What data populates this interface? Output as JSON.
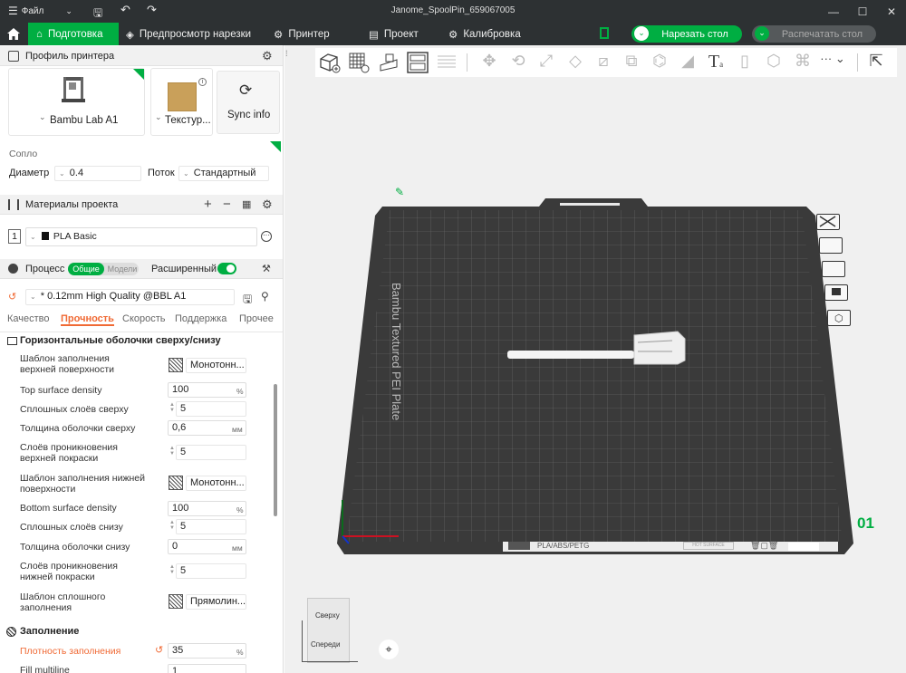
{
  "window": {
    "title": "Janome_SpoolPin_659067005",
    "menu_label": "Файл"
  },
  "nav": {
    "tabs": [
      "Подготовка",
      "Предпросмотр нарезки",
      "Принтер",
      "Проект",
      "Калибровка"
    ],
    "slice_button": "Нарезать стол",
    "print_button": "Распечатать стол"
  },
  "printer_profile": {
    "header": "Профиль принтера",
    "printer_name": "Bambu Lab A1",
    "plate_name": "Текстур...",
    "sync_label": "Sync info",
    "nozzle_label": "Сопло",
    "diameter_label": "Диаметр",
    "diameter_value": "0.4",
    "flow_label": "Поток",
    "flow_value": "Стандартный"
  },
  "materials": {
    "header": "Материалы проекта",
    "slot": "1",
    "filament": "PLA Basic"
  },
  "process": {
    "header": "Процесс",
    "toggle_global": "Общие",
    "toggle_objects": "Модели",
    "advanced_label": "Расширенный",
    "preset": "* 0.12mm High Quality @BBL A1",
    "tabs": [
      "Качество",
      "Прочность",
      "Скорость",
      "Поддержка",
      "Прочее"
    ],
    "active_tab": "Прочность"
  },
  "shells": {
    "title": "Горизонтальные оболочки сверху/снизу",
    "rows": [
      {
        "label": "Шаблон заполнения верхней поверхности",
        "value": "Монотонн...",
        "unit": ""
      },
      {
        "label": "Top surface density",
        "value": "100",
        "unit": "%"
      },
      {
        "label": "Сплошных слоёв сверху",
        "value": "5",
        "unit": ""
      },
      {
        "label": "Толщина оболочки сверху",
        "value": "0,6",
        "unit": "мм"
      },
      {
        "label": "Слоёв проникновения верхней покраски",
        "value": "5",
        "unit": ""
      },
      {
        "label": "Шаблон заполнения нижней поверхности",
        "value": "Монотонн...",
        "unit": ""
      },
      {
        "label": "Bottom surface density",
        "value": "100",
        "unit": "%"
      },
      {
        "label": "Сплошных слоёв снизу",
        "value": "5",
        "unit": ""
      },
      {
        "label": "Толщина оболочки снизу",
        "value": "0",
        "unit": "мм"
      },
      {
        "label": "Слоёв проникновения нижней покраски",
        "value": "5",
        "unit": ""
      },
      {
        "label": "Шаблон сплошного заполнения",
        "value": "Прямолин...",
        "unit": ""
      }
    ]
  },
  "infill": {
    "title": "Заполнение",
    "density_label": "Плотность заполнения",
    "density_value": "35",
    "density_unit": "%",
    "multiline_label": "Fill multiline",
    "multiline_value": "1"
  },
  "plate": {
    "brand_text": "Bambu Textured PEI Plate",
    "footer_text": "PLA/ABS/PETG",
    "hot_text": "HOT SURFACE",
    "number": "01"
  },
  "navcube": {
    "top": "Сверху",
    "front": "Спереди"
  },
  "colors": {
    "accent": "#00ae42",
    "dark": "#2d3133",
    "orange": "#f06a35"
  }
}
